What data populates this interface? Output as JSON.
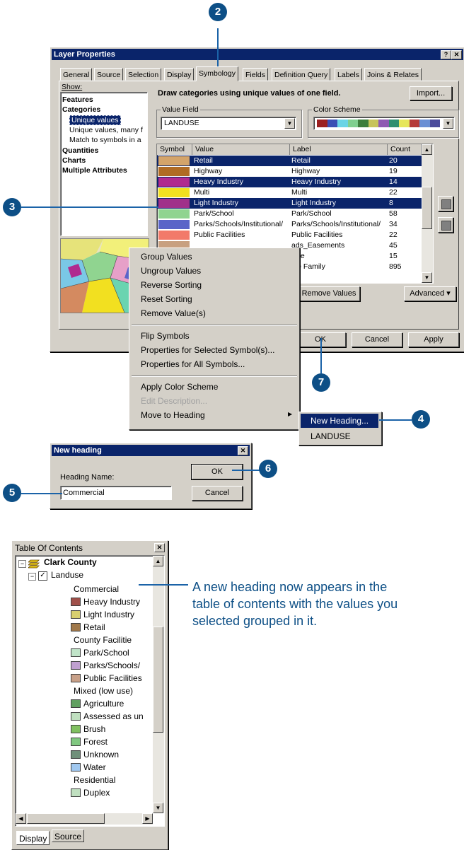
{
  "callouts": [
    "2",
    "3",
    "4",
    "5",
    "6",
    "7"
  ],
  "layer_properties": {
    "title": "Layer Properties",
    "tabs": [
      "General",
      "Source",
      "Selection",
      "Display",
      "Symbology",
      "Fields",
      "Definition Query",
      "Labels",
      "Joins & Relates"
    ],
    "active_tab": "Symbology",
    "show_label": "Show:",
    "show_tree": [
      {
        "label": "Features",
        "bold": true
      },
      {
        "label": "Categories",
        "bold": true
      },
      {
        "label": "Unique values",
        "selected": true
      },
      {
        "label": "Unique values, many f"
      },
      {
        "label": "Match to symbols in a"
      },
      {
        "label": "Quantities",
        "bold": true
      },
      {
        "label": "Charts",
        "bold": true
      },
      {
        "label": "Multiple Attributes",
        "bold": true
      }
    ],
    "heading": "Draw categories using unique values of one field.",
    "import_button": "Import...",
    "value_field_label": "Value Field",
    "value_field_value": "LANDUSE",
    "color_scheme_label": "Color Scheme",
    "color_scheme_colors": [
      "#9b2020",
      "#3a4fb5",
      "#6ad4e6",
      "#7fcf8f",
      "#3c7d3c",
      "#c7c35a",
      "#8f5bb2",
      "#2f8f6f",
      "#e6e65a",
      "#b53a3a",
      "#6a8fd4",
      "#4a4a9b"
    ],
    "columns": [
      "Symbol",
      "Value",
      "Label",
      "Count"
    ],
    "rows": [
      {
        "color": "#d4a46a",
        "value": "Retail",
        "label": "Retail",
        "count": "20",
        "selected": true
      },
      {
        "color": "#b06b24",
        "value": "Highway",
        "label": "Highway",
        "count": "19",
        "selected": false
      },
      {
        "color": "#b02a8f",
        "value": "Heavy Industry",
        "label": "Heavy Industry",
        "count": "14",
        "selected": true
      },
      {
        "color": "#f2e020",
        "value": "Multi",
        "label": "Multi",
        "count": "22",
        "selected": false
      },
      {
        "color": "#a0308a",
        "value": "Light Industry",
        "label": "Light Industry",
        "count": "8",
        "selected": true
      },
      {
        "color": "#90d490",
        "value": "Park/School",
        "label": "Park/School",
        "count": "58",
        "selected": false
      },
      {
        "color": "#5a64c8",
        "value": "Parks/Schools/Institutional/",
        "label": "Parks/Schools/Institutional/",
        "count": "34",
        "selected": false
      },
      {
        "color": "#f27a6a",
        "value": "Public Facilities",
        "label": "Public Facilities",
        "count": "22",
        "selected": false
      },
      {
        "color": "#c8a080",
        "value": "",
        "label": "ads_Easements",
        "count": "45",
        "selected": false
      },
      {
        "color": "#a0c060",
        "value": "",
        "label": "vice",
        "count": "15",
        "selected": false
      },
      {
        "color": "#f0d060",
        "value": "",
        "label": "gle Family",
        "count": "895",
        "selected": false
      }
    ],
    "remove_values_button": "Remove Values",
    "advanced_button": "Advanced",
    "ok_button": "OK",
    "cancel_button": "Cancel",
    "apply_button": "Apply"
  },
  "context_menu": {
    "group1": [
      "Group Values",
      "Ungroup Values",
      "Reverse Sorting",
      "Reset Sorting",
      "Remove Value(s)"
    ],
    "group2": [
      "Flip Symbols",
      "Properties for Selected Symbol(s)...",
      "Properties for All Symbols..."
    ],
    "group3_apply": "Apply Color Scheme",
    "group3_edit": "Edit Description...",
    "group3_move": "Move to Heading"
  },
  "submenu": {
    "items": [
      "New Heading...",
      "LANDUSE"
    ]
  },
  "new_heading": {
    "title": "New heading",
    "label": "Heading Name:",
    "value": "Commercial",
    "ok_button": "OK",
    "cancel_button": "Cancel"
  },
  "toc": {
    "title": "Table Of Contents",
    "map_name": "Clark County",
    "layer_name": "Landuse",
    "items": [
      {
        "type": "heading",
        "label": "Commercial"
      },
      {
        "type": "item",
        "label": "Heavy Industry",
        "color": "#a0504a"
      },
      {
        "type": "item",
        "label": "Light Industry",
        "color": "#d8d070"
      },
      {
        "type": "item",
        "label": "Retail",
        "color": "#a0784a"
      },
      {
        "type": "heading",
        "label": "County Facilitie"
      },
      {
        "type": "item",
        "label": "Park/School",
        "color": "#c0e4c8"
      },
      {
        "type": "item",
        "label": "Parks/Schools/",
        "color": "#c0a0d0"
      },
      {
        "type": "item",
        "label": "Public Facilities",
        "color": "#c8a088"
      },
      {
        "type": "heading",
        "label": "Mixed (low use)"
      },
      {
        "type": "item",
        "label": "Agriculture",
        "color": "#60a060"
      },
      {
        "type": "item",
        "label": "Assessed as un",
        "color": "#c0e0c0"
      },
      {
        "type": "item",
        "label": "Brush",
        "color": "#80c060"
      },
      {
        "type": "item",
        "label": "Forest",
        "color": "#80c880"
      },
      {
        "type": "item",
        "label": "Unknown",
        "color": "#70907a"
      },
      {
        "type": "item",
        "label": "Water",
        "color": "#a0c8f0"
      },
      {
        "type": "heading",
        "label": "Residential"
      },
      {
        "type": "item",
        "label": "Duplex",
        "color": "#c0e0c0"
      }
    ],
    "tabs": [
      "Display",
      "Source"
    ]
  },
  "annotation": "A new heading now appears in the table of contents with the values you selected grouped in it."
}
